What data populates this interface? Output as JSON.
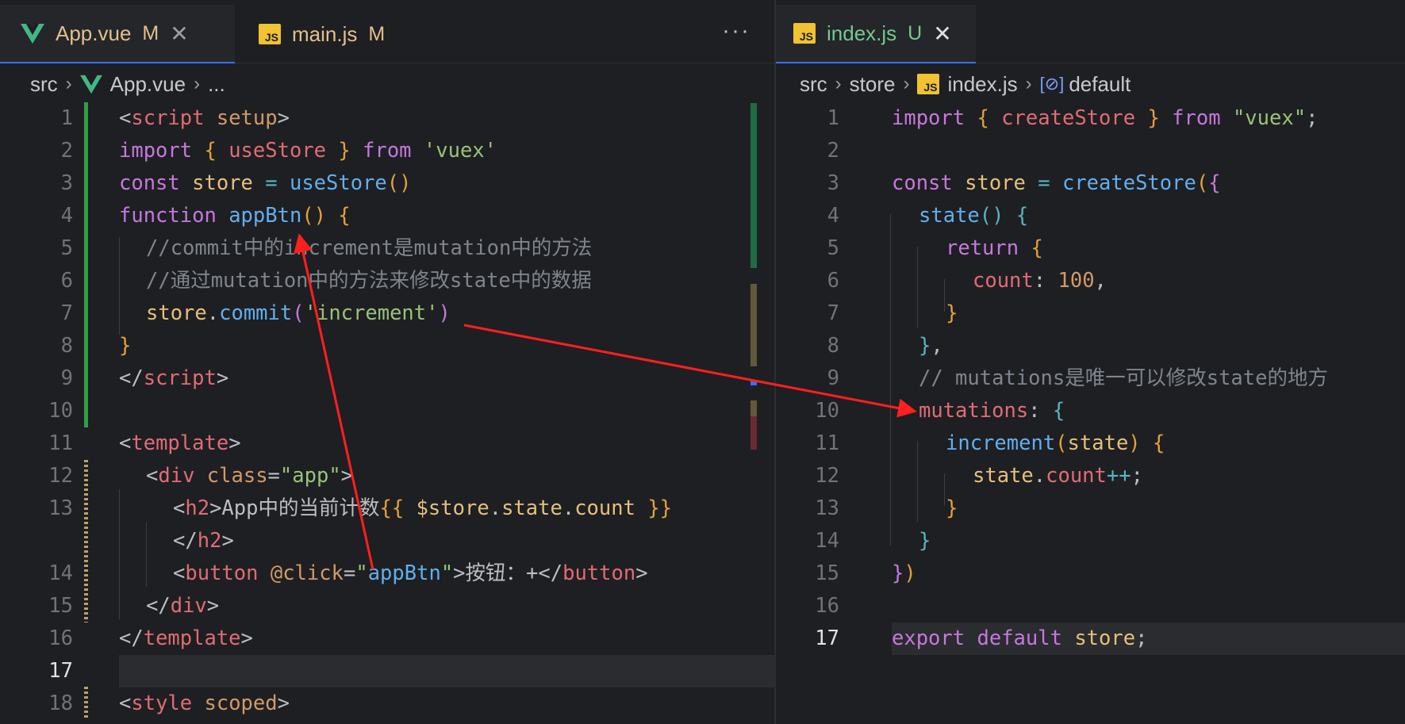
{
  "left_editor": {
    "tabs": [
      {
        "label": "App.vue",
        "status": "M",
        "icon": "vue-icon",
        "close": "✕",
        "active": true
      },
      {
        "label": "main.js",
        "status": "M",
        "icon": "js-icon",
        "active": false
      }
    ],
    "more_label": "···",
    "breadcrumb": {
      "folder": "src",
      "file": "App.vue",
      "symbol": "..."
    },
    "line_numbers": [
      "1",
      "2",
      "3",
      "4",
      "5",
      "6",
      "7",
      "8",
      "9",
      "10",
      "11",
      "12",
      "13",
      "14",
      "15",
      "16",
      "17",
      "18"
    ],
    "current_line": "17"
  },
  "right_editor": {
    "tabs": [
      {
        "label": "index.js",
        "status": "U",
        "icon": "js-icon",
        "close": "✕",
        "active": true
      }
    ],
    "breadcrumb": {
      "folder": "src",
      "subfolder": "store",
      "file": "index.js",
      "symbol": "default"
    },
    "line_numbers": [
      "1",
      "2",
      "3",
      "4",
      "5",
      "6",
      "7",
      "8",
      "9",
      "10",
      "11",
      "12",
      "13",
      "14",
      "15",
      "16",
      "17"
    ],
    "current_line": "17"
  },
  "colors": {
    "tab_modified": "#e2c08d",
    "tab_untracked": "#73c991",
    "gutter_added": "#2ea043",
    "gutter_modified": "#b5a36a",
    "arrow": "#ff1f1f"
  }
}
